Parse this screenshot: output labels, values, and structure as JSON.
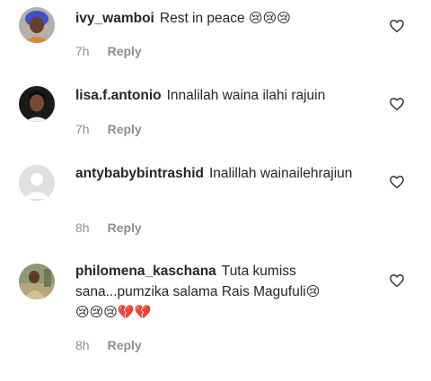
{
  "comments": [
    {
      "username": "ivy_wamboi",
      "text": "Rest in peace",
      "emojis": "😢😢😢",
      "time": "7h",
      "reply_label": "Reply",
      "avatar_icon": "avatar-photo-icon"
    },
    {
      "username": "lisa.f.antonio",
      "text": "Innalilah waina ilahi rajuin",
      "emojis": "",
      "time": "7h",
      "reply_label": "Reply",
      "avatar_icon": "avatar-photo-icon"
    },
    {
      "username": "antybabybintrashid",
      "text": "Inalillah wainailehrajiun",
      "emojis": "",
      "time": "8h",
      "reply_label": "Reply",
      "avatar_icon": "default-avatar-icon"
    },
    {
      "username": "philomena_kaschana",
      "text": "Tuta kumiss sana...pumzika salama Rais Magufuli",
      "emojis": "😢",
      "emojis_line2": "😢😢😢💔💔",
      "time": "8h",
      "reply_label": "Reply",
      "avatar_icon": "avatar-photo-icon"
    }
  ],
  "icons": {
    "like": "heart-outline-icon"
  },
  "colors": {
    "text": "#262626",
    "meta": "#8e8e8e",
    "background": "#ffffff"
  }
}
